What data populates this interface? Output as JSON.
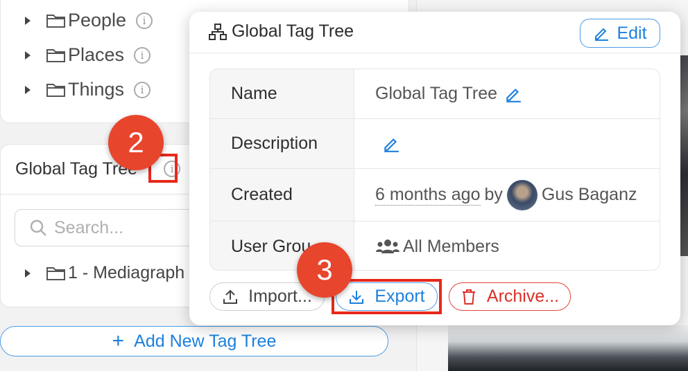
{
  "sidebar": {
    "tree_items": [
      {
        "label": "People"
      },
      {
        "label": "Places"
      },
      {
        "label": "Things"
      }
    ],
    "tag_tree_title": "Global Tag Tree",
    "search_placeholder": "Search...",
    "sub_item": "1 - Mediagraph",
    "add_button": "Add New Tag Tree"
  },
  "popover": {
    "title": "Global Tag Tree",
    "edit_label": "Edit",
    "rows": [
      {
        "key": "Name",
        "value": "Global Tag Tree"
      },
      {
        "key": "Description",
        "value": ""
      },
      {
        "key": "Created",
        "value": "6 months ago",
        "by": "by",
        "user": "Gus Baganz"
      },
      {
        "key": "User Grou",
        "value": "All Members"
      }
    ],
    "buttons": {
      "import": "Import...",
      "export": "Export",
      "archive": "Archive..."
    }
  },
  "annotations": {
    "badge_2": "2",
    "badge_3": "3"
  },
  "colors": {
    "accent": "#1d80de",
    "danger": "#d93027",
    "badge": "#e8452d",
    "highlight": "#e8281c"
  }
}
